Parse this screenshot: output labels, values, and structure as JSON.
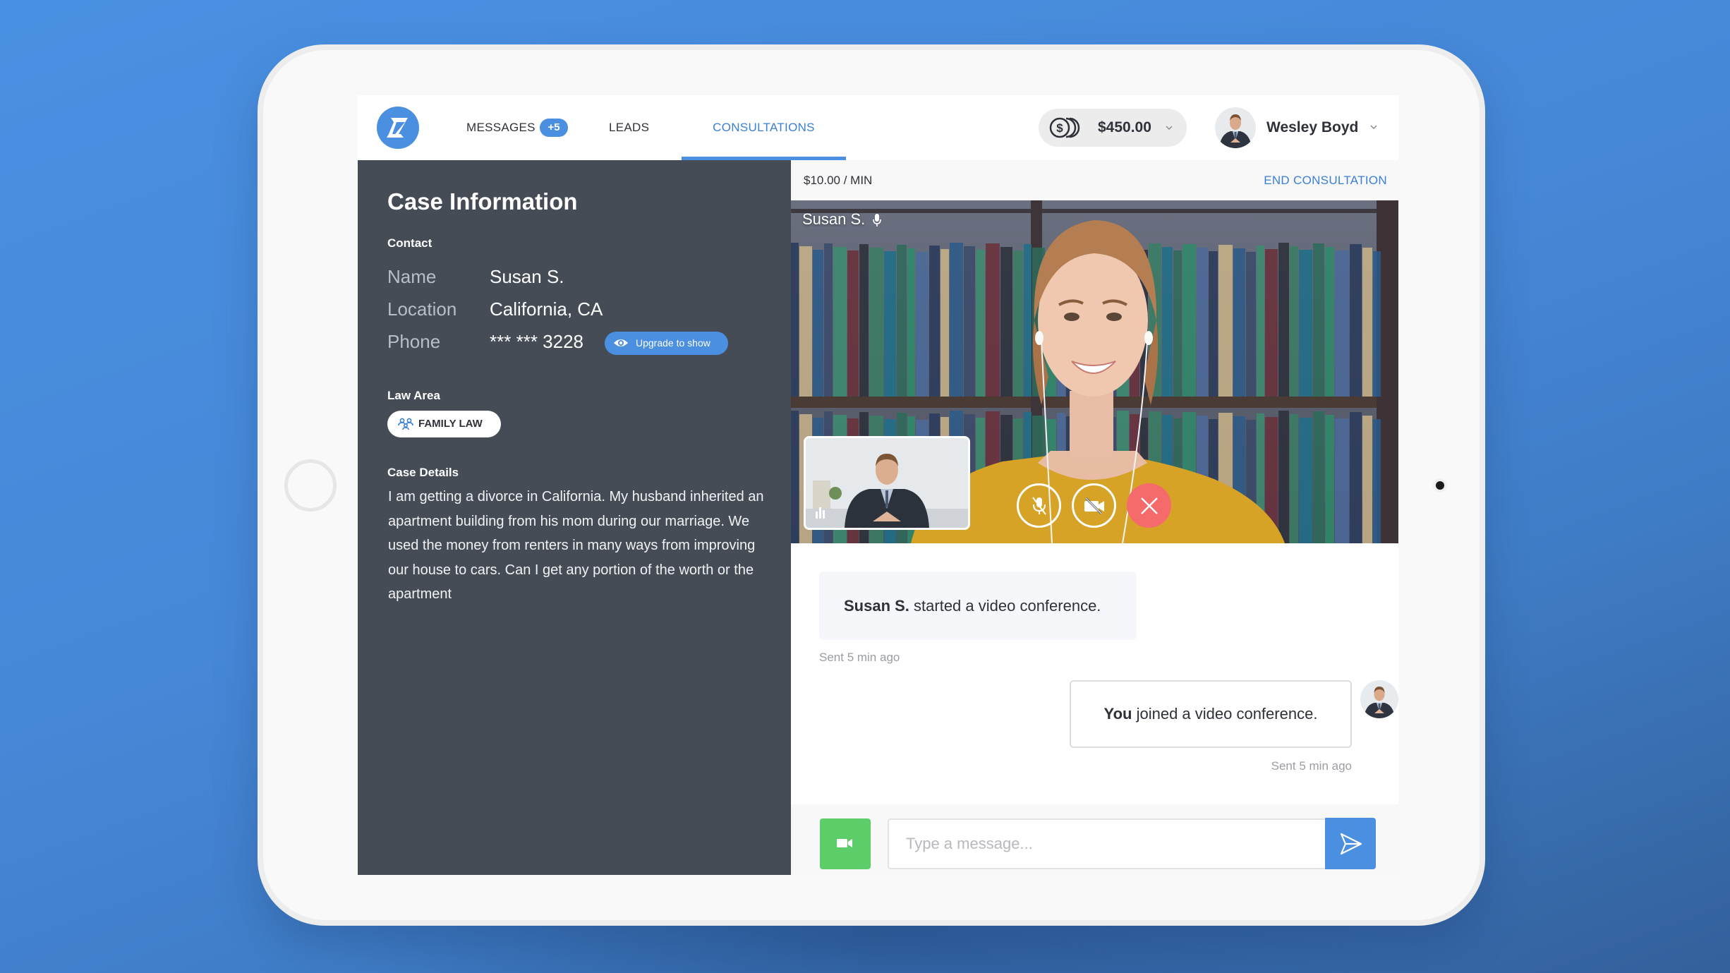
{
  "nav": {
    "tabs": [
      {
        "label": "MESSAGES",
        "badge": "+5",
        "active": false
      },
      {
        "label": "LEADS",
        "active": false
      },
      {
        "label": "CONSULTATIONS",
        "active": true
      }
    ],
    "wallet": {
      "icon": "coins-icon",
      "amount": "$450.00"
    },
    "user": {
      "name": "Wesley Boyd"
    }
  },
  "case": {
    "title": "Case Information",
    "contact_label": "Contact",
    "fields": [
      {
        "key": "Name",
        "value": "Susan S."
      },
      {
        "key": "Location",
        "value": "California, CA"
      },
      {
        "key": "Phone",
        "value": "*** *** 3228"
      }
    ],
    "upgrade_label": "Upgrade to show",
    "law_area_label": "Law Area",
    "law_area": "FAMILY LAW",
    "details_label": "Case Details",
    "details_text": "I am getting a divorce in California. My husband inherited an apartment building from his mom during our marriage. We used the money from renters in many ways from improving our house to cars. Can I get any portion of the worth or the apartment"
  },
  "consultation": {
    "rate": "$10.00 / MIN",
    "end_label": "END CONSULTATION",
    "remote_participant": "Susan S.",
    "controls": [
      "mute-microphone",
      "disable-camera",
      "end-call"
    ]
  },
  "chat": {
    "messages": [
      {
        "sender": "Susan S.",
        "text": " started a video conference.",
        "time": "Sent 5 min ago",
        "direction": "incoming"
      },
      {
        "sender": "You",
        "text": " joined a video conference.",
        "time": "Sent 5 min ago",
        "direction": "outgoing"
      }
    ],
    "input_placeholder": "Type a message...",
    "input_value": ""
  },
  "colors": {
    "accent": "#4a8fe0",
    "panel": "#464c56",
    "success": "#5ccd68",
    "danger": "#f56b6b",
    "background": "#4a90e2"
  }
}
